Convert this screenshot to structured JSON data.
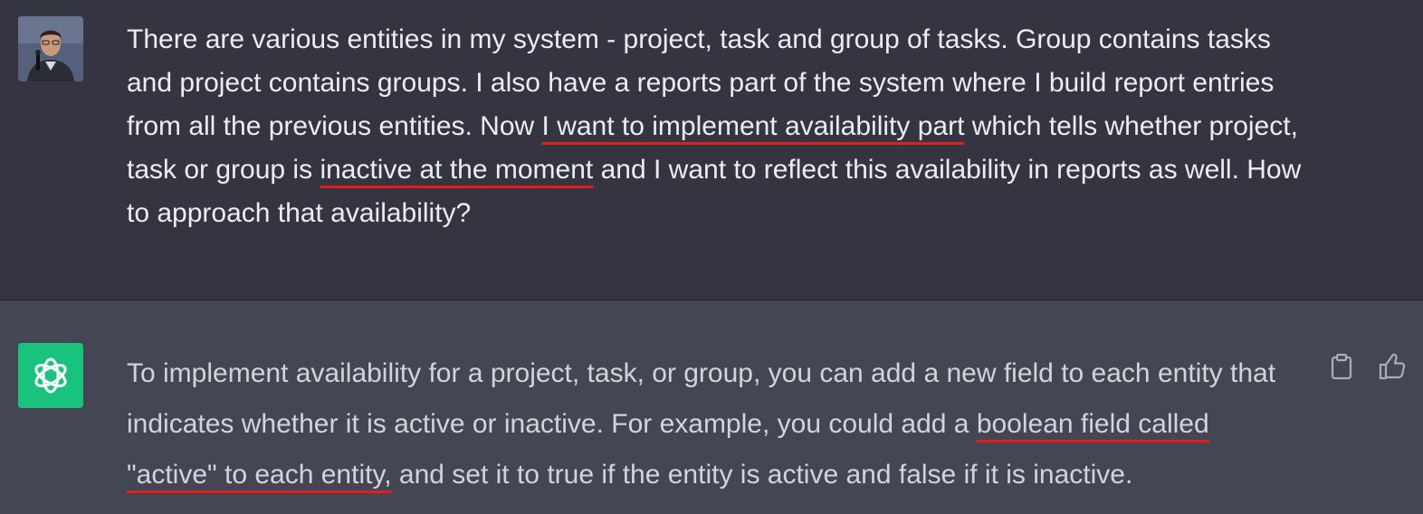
{
  "user_message": {
    "p1": "There are various entities in my system - project, task and group of tasks. Group contains tasks and project contains groups. I also have a reports part of the system where I build report entries from all the previous entities. Now ",
    "hl1": "I want to implement availability part",
    "p2": " which tells whether project, task or group is ",
    "hl2": "inactive at the moment",
    "p3": " and I want to reflect this availability in reports as well. How to approach that availability?"
  },
  "assistant_message": {
    "p1": "To implement availability for a project, task, or group, you can add a new field to each entity that indicates whether it is active or inactive. For example, you could add a ",
    "hl1": "boolean field called \"active\" to each entity,",
    "p2": " and set it to true if the entity is active and false if it is inactive."
  },
  "icons": {
    "user_avatar": "user-photo-avatar",
    "bot_avatar": "openai-logo-icon",
    "copy": "clipboard-icon",
    "like": "thumbs-up-icon"
  },
  "colors": {
    "user_bg": "#343541",
    "assistant_bg": "#444654",
    "bot_avatar_bg": "#19c37d",
    "annotation": "#e0211b"
  }
}
